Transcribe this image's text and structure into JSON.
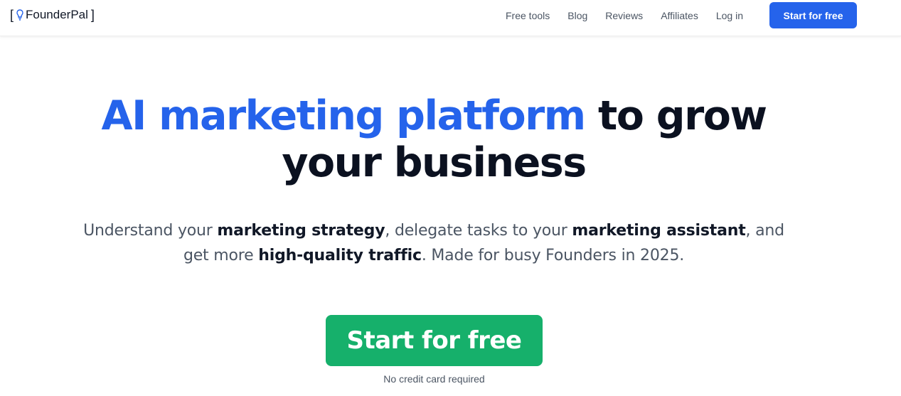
{
  "header": {
    "logo": {
      "bracket_left": "[",
      "name": "FounderPal",
      "bracket_right": "]",
      "icon": "lightbulb-icon"
    },
    "nav": [
      "Free tools",
      "Blog",
      "Reviews",
      "Affiliates",
      "Log in"
    ],
    "cta_label": "Start for free"
  },
  "hero": {
    "title_accent": "AI marketing platform",
    "title_rest_1": "to grow",
    "title_rest_2": "your business",
    "sub": {
      "p1": "Understand your ",
      "b1": "marketing strategy",
      "p2": ", delegate tasks to your ",
      "b2": "marketing assistant",
      "p3": ", and get more ",
      "b3": "high-quality traffic",
      "p4": ". Made for busy Founders in 2025."
    },
    "cta_label": "Start for free",
    "cta_note": "No credit card required"
  },
  "colors": {
    "accent_blue": "#2563eb",
    "cta_green": "#16b06b",
    "heading_dark": "#0b1120",
    "text_gray": "#4b5563"
  }
}
